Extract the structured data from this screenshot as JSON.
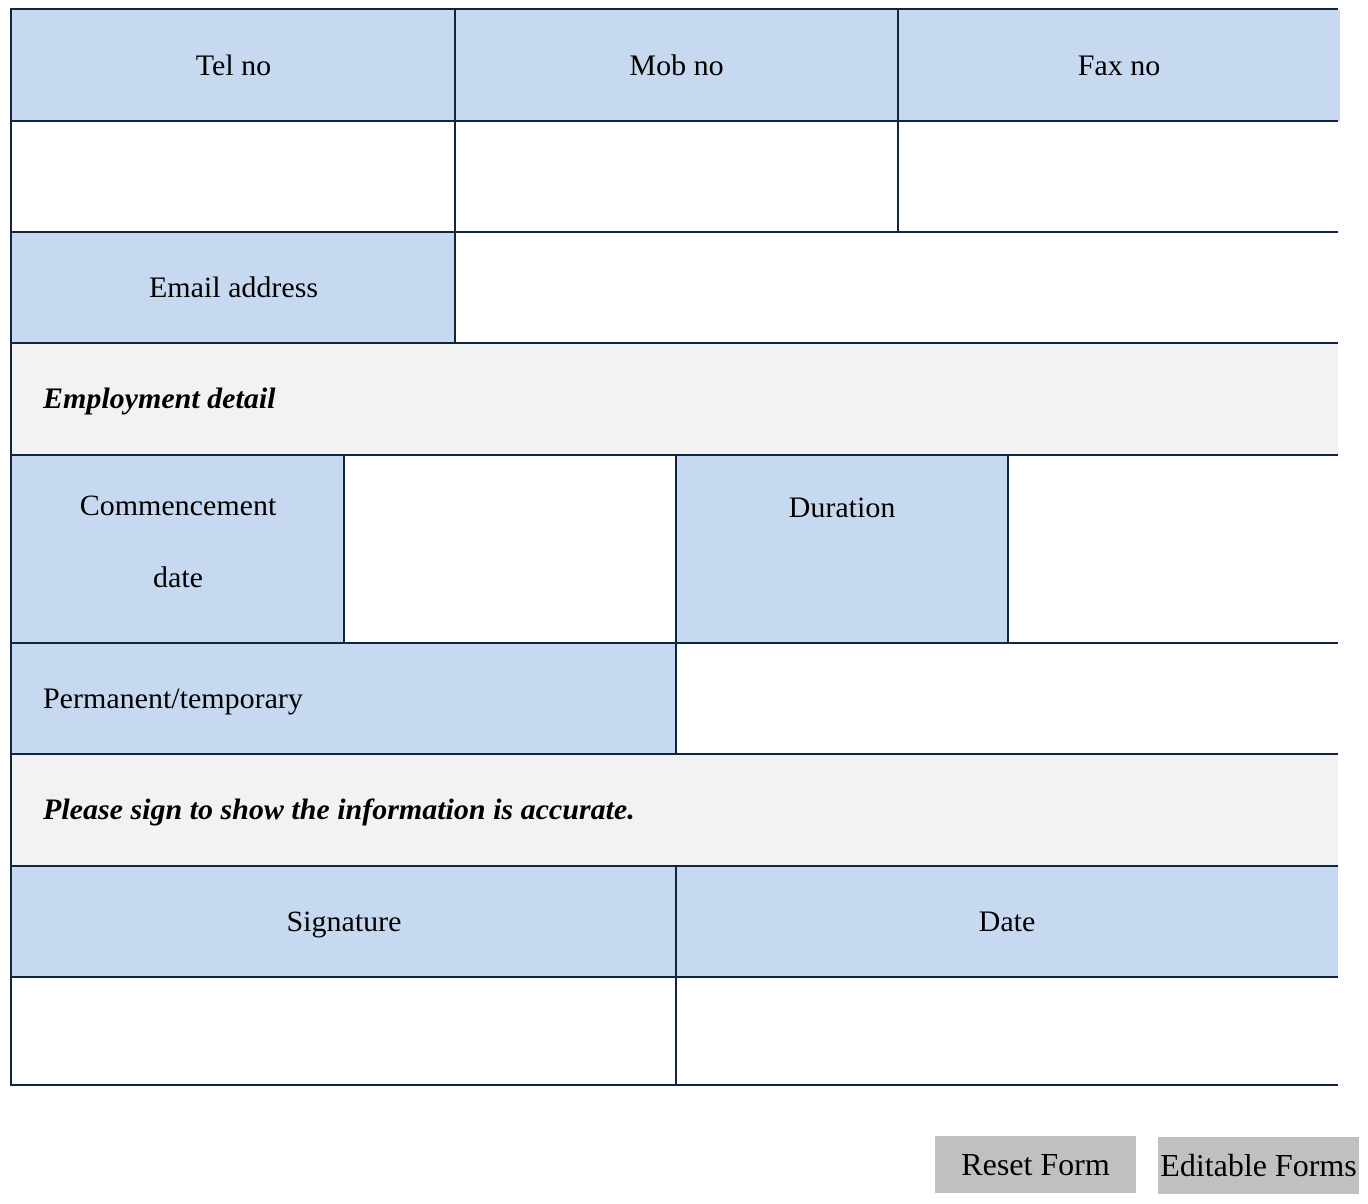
{
  "contact": {
    "headers": [
      "Tel no",
      "Mob no",
      "Fax no"
    ],
    "values": [
      "",
      "",
      ""
    ],
    "email_label": "Email address",
    "email_value": ""
  },
  "employment": {
    "section_title": "Employment detail",
    "commencement_label_line1": "Commencement",
    "commencement_label_line2": "date",
    "commencement_value": "",
    "duration_label": "Duration",
    "duration_value": "",
    "permanent_label": "Permanent/temporary",
    "permanent_value": ""
  },
  "signoff": {
    "section_title": "Please sign to show the information is accurate.",
    "signature_label": "Signature",
    "date_label": "Date",
    "signature_value": "",
    "date_value": ""
  },
  "buttons": {
    "reset": "Reset Form",
    "editable": "Editable Forms"
  },
  "colors": {
    "header_bg": "#c6d9f0",
    "section_bg": "#f2f2f2",
    "border": "#0f2540",
    "button_bg": "#c0c0c0"
  }
}
